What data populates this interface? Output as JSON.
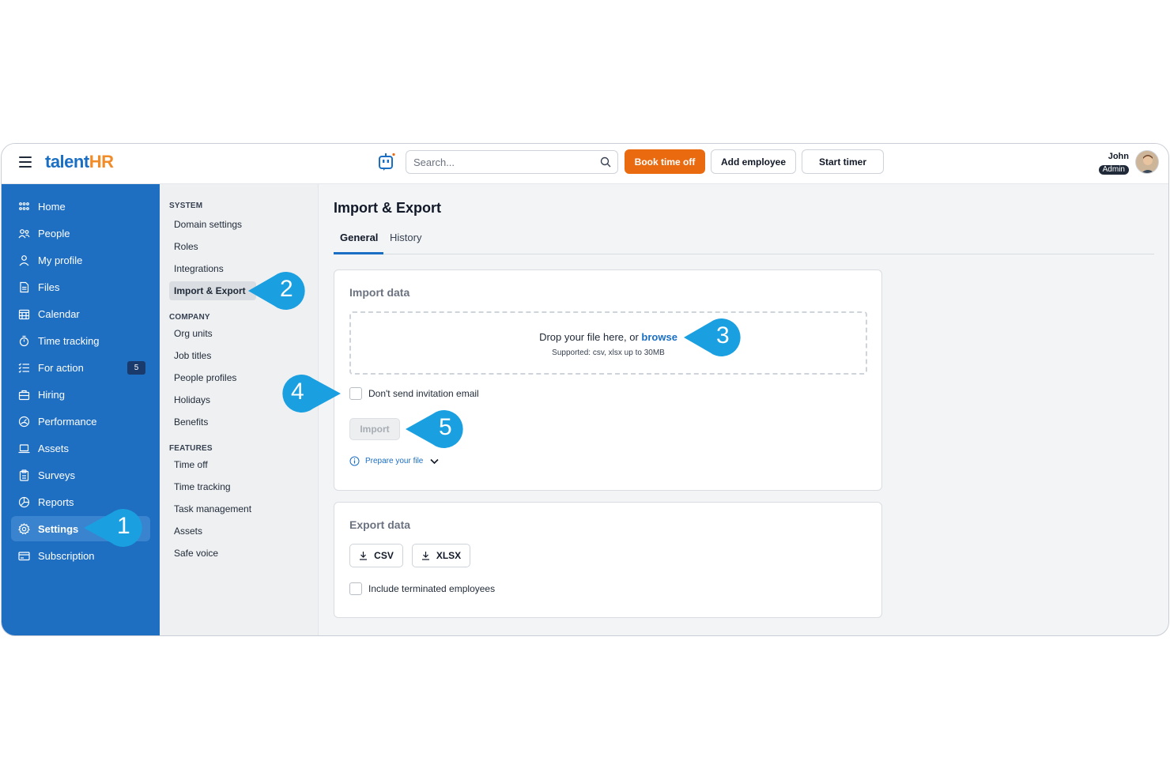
{
  "app": {
    "logo_main": "talent",
    "logo_accent": "HR"
  },
  "header": {
    "search_placeholder": "Search...",
    "book_time_off": "Book time off",
    "add_employee": "Add employee",
    "start_timer": "Start timer",
    "user_name": "John",
    "user_role": "Admin"
  },
  "sidebar": {
    "items": [
      {
        "label": "Home",
        "icon": "grid-icon"
      },
      {
        "label": "People",
        "icon": "people-icon"
      },
      {
        "label": "My profile",
        "icon": "user-icon"
      },
      {
        "label": "Files",
        "icon": "file-icon"
      },
      {
        "label": "Calendar",
        "icon": "calendar-icon"
      },
      {
        "label": "Time tracking",
        "icon": "stopwatch-icon"
      },
      {
        "label": "For action",
        "icon": "checklist-icon",
        "badge": "5"
      },
      {
        "label": "Hiring",
        "icon": "briefcase-icon"
      },
      {
        "label": "Performance",
        "icon": "gauge-icon"
      },
      {
        "label": "Assets",
        "icon": "laptop-icon"
      },
      {
        "label": "Surveys",
        "icon": "clipboard-icon"
      },
      {
        "label": "Reports",
        "icon": "chart-pie-icon"
      },
      {
        "label": "Settings",
        "icon": "gear-icon",
        "active": true
      },
      {
        "label": "Subscription",
        "icon": "card-icon"
      }
    ]
  },
  "submenu": {
    "system_heading": "SYSTEM",
    "system_items": [
      "Domain settings",
      "Roles",
      "Integrations",
      "Import & Export"
    ],
    "company_heading": "COMPANY",
    "company_items": [
      "Org units",
      "Job titles",
      "People profiles",
      "Holidays",
      "Benefits"
    ],
    "features_heading": "FEATURES",
    "features_items": [
      "Time off",
      "Time tracking",
      "Task management",
      "Assets",
      "Safe voice"
    ]
  },
  "main": {
    "title": "Import & Export",
    "tabs": [
      {
        "label": "General",
        "active": true
      },
      {
        "label": "History"
      }
    ],
    "import": {
      "title": "Import data",
      "drop_text": "Drop your file here, or",
      "drop_link": "browse",
      "supported": "Supported:  csv, xlsx up to 30MB",
      "no_invite_label": "Don't send invitation email",
      "import_button": "Import",
      "prepare_link": "Prepare your file"
    },
    "export": {
      "title": "Export data",
      "csv_button": "CSV",
      "xlsx_button": "XLSX",
      "include_terminated_label": "Include terminated employees"
    }
  },
  "callouts": [
    "1",
    "2",
    "3",
    "4",
    "5"
  ],
  "colors": {
    "sidebar": "#1e6ec2",
    "brand_blue": "#1a6fc4",
    "brand_orange": "#ea6a10",
    "callout": "#1aa0e0"
  }
}
